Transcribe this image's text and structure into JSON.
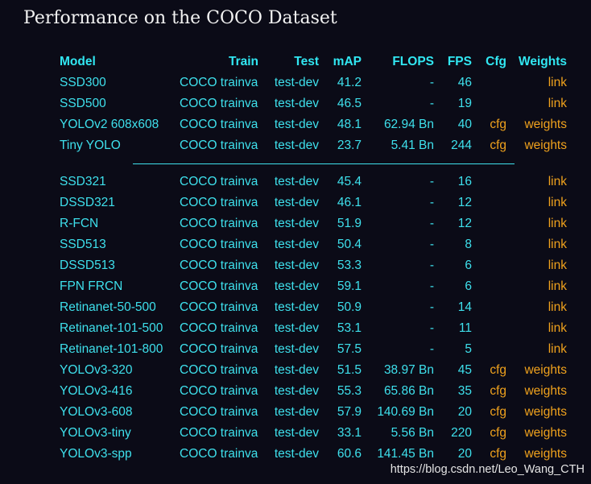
{
  "title": "Performance on the COCO Dataset",
  "columns": {
    "model": "Model",
    "train": "Train",
    "test": "Test",
    "map": "mAP",
    "flops": "FLOPS",
    "fps": "FPS",
    "cfg": "Cfg",
    "weights": "Weights"
  },
  "group1": [
    {
      "model": "SSD300",
      "train": "COCO trainval",
      "test": "test-dev",
      "map": "41.2",
      "flops": "-",
      "fps": "46",
      "cfg": "",
      "weights": "link"
    },
    {
      "model": "SSD500",
      "train": "COCO trainval",
      "test": "test-dev",
      "map": "46.5",
      "flops": "-",
      "fps": "19",
      "cfg": "",
      "weights": "link"
    },
    {
      "model": "YOLOv2 608x608",
      "train": "COCO trainval",
      "test": "test-dev",
      "map": "48.1",
      "flops": "62.94 Bn",
      "fps": "40",
      "cfg": "cfg",
      "weights": "weights"
    },
    {
      "model": "Tiny YOLO",
      "train": "COCO trainval",
      "test": "test-dev",
      "map": "23.7",
      "flops": "5.41 Bn",
      "fps": "244",
      "cfg": "cfg",
      "weights": "weights"
    }
  ],
  "group2": [
    {
      "model": "SSD321",
      "train": "COCO trainval",
      "test": "test-dev",
      "map": "45.4",
      "flops": "-",
      "fps": "16",
      "cfg": "",
      "weights": "link"
    },
    {
      "model": "DSSD321",
      "train": "COCO trainval",
      "test": "test-dev",
      "map": "46.1",
      "flops": "-",
      "fps": "12",
      "cfg": "",
      "weights": "link"
    },
    {
      "model": "R-FCN",
      "train": "COCO trainval",
      "test": "test-dev",
      "map": "51.9",
      "flops": "-",
      "fps": "12",
      "cfg": "",
      "weights": "link"
    },
    {
      "model": "SSD513",
      "train": "COCO trainval",
      "test": "test-dev",
      "map": "50.4",
      "flops": "-",
      "fps": "8",
      "cfg": "",
      "weights": "link"
    },
    {
      "model": "DSSD513",
      "train": "COCO trainval",
      "test": "test-dev",
      "map": "53.3",
      "flops": "-",
      "fps": "6",
      "cfg": "",
      "weights": "link"
    },
    {
      "model": "FPN FRCN",
      "train": "COCO trainval",
      "test": "test-dev",
      "map": "59.1",
      "flops": "-",
      "fps": "6",
      "cfg": "",
      "weights": "link"
    },
    {
      "model": "Retinanet-50-500",
      "train": "COCO trainval",
      "test": "test-dev",
      "map": "50.9",
      "flops": "-",
      "fps": "14",
      "cfg": "",
      "weights": "link"
    },
    {
      "model": "Retinanet-101-500",
      "train": "COCO trainval",
      "test": "test-dev",
      "map": "53.1",
      "flops": "-",
      "fps": "11",
      "cfg": "",
      "weights": "link"
    },
    {
      "model": "Retinanet-101-800",
      "train": "COCO trainval",
      "test": "test-dev",
      "map": "57.5",
      "flops": "-",
      "fps": "5",
      "cfg": "",
      "weights": "link"
    },
    {
      "model": "YOLOv3-320",
      "train": "COCO trainval",
      "test": "test-dev",
      "map": "51.5",
      "flops": "38.97 Bn",
      "fps": "45",
      "cfg": "cfg",
      "weights": "weights"
    },
    {
      "model": "YOLOv3-416",
      "train": "COCO trainval",
      "test": "test-dev",
      "map": "55.3",
      "flops": "65.86 Bn",
      "fps": "35",
      "cfg": "cfg",
      "weights": "weights"
    },
    {
      "model": "YOLOv3-608",
      "train": "COCO trainval",
      "test": "test-dev",
      "map": "57.9",
      "flops": "140.69 Bn",
      "fps": "20",
      "cfg": "cfg",
      "weights": "weights"
    },
    {
      "model": "YOLOv3-tiny",
      "train": "COCO trainval",
      "test": "test-dev",
      "map": "33.1",
      "flops": "5.56 Bn",
      "fps": "220",
      "cfg": "cfg",
      "weights": "weights"
    },
    {
      "model": "YOLOv3-spp",
      "train": "COCO trainval",
      "test": "test-dev",
      "map": "60.6",
      "flops": "141.45 Bn",
      "fps": "20",
      "cfg": "cfg",
      "weights": "weights"
    }
  ],
  "watermark": "https://blog.csdn.net/Leo_Wang_CTH",
  "colors": {
    "background": "#0b0b17",
    "text": "#3ee0ec",
    "link": "#f0a21d",
    "title": "#f2f2f2"
  }
}
